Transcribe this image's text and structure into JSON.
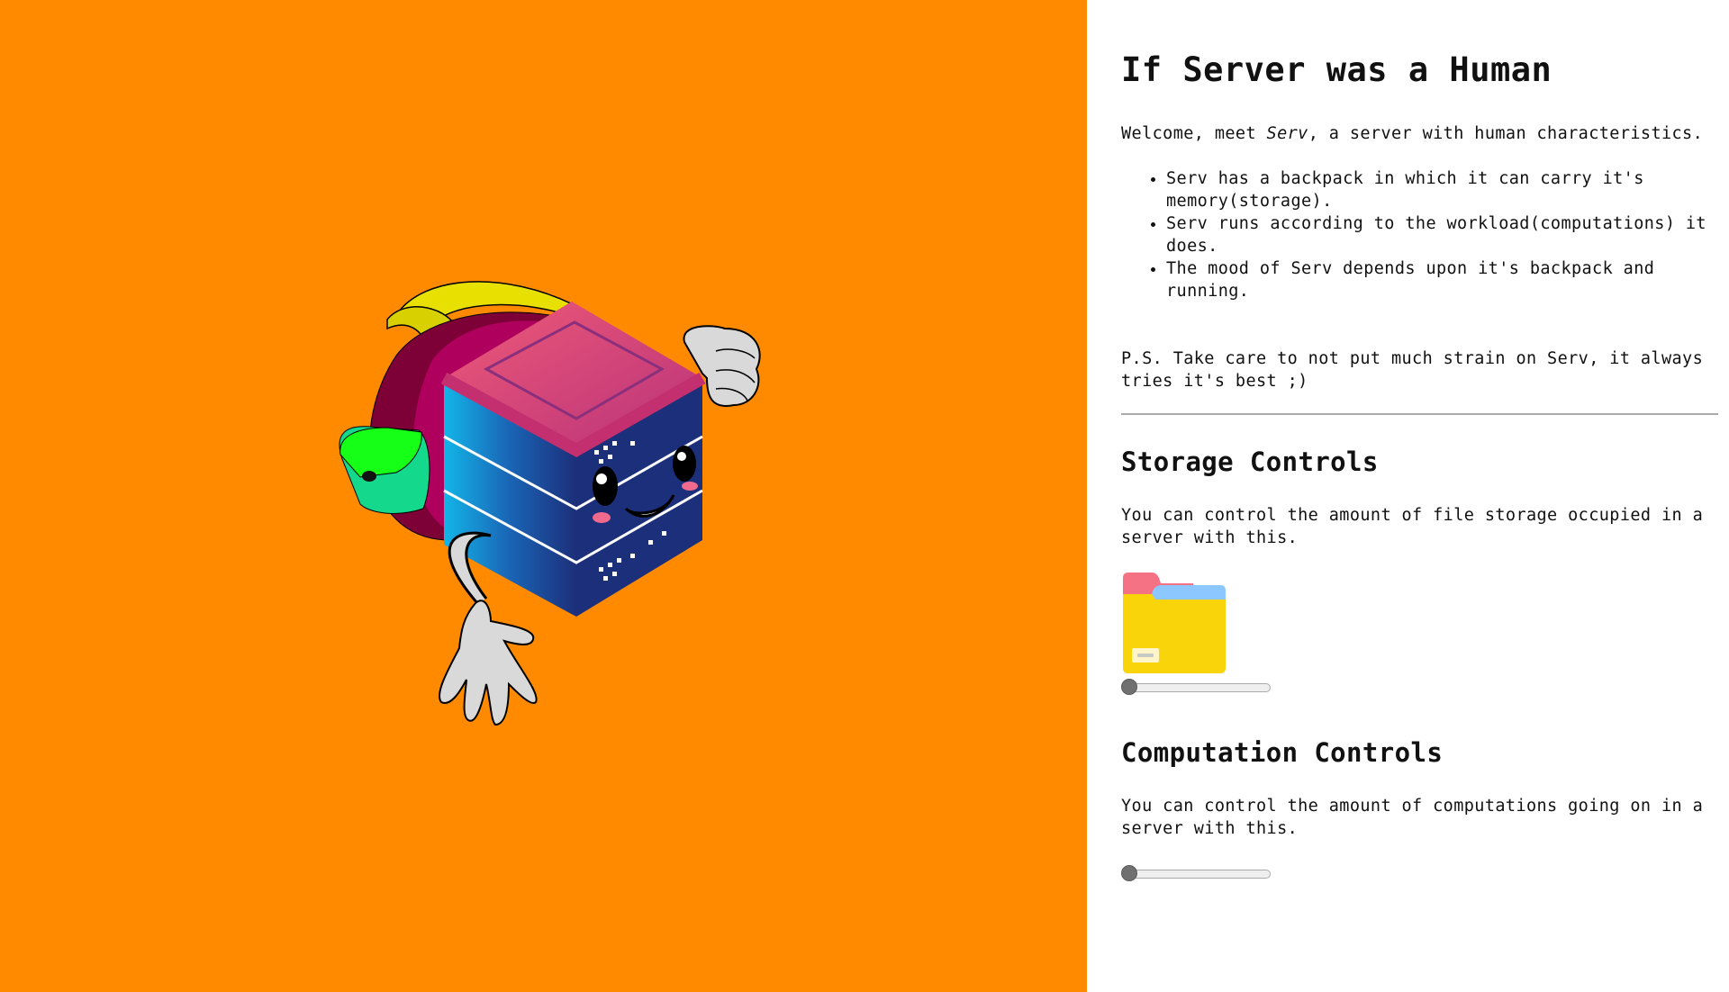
{
  "stage": {
    "background": "#ff8a00",
    "illustration": "server-character-illustration"
  },
  "panel": {
    "title": "If Server was a Human",
    "welcome_before": "Welcome, meet ",
    "welcome_name": "Serv",
    "welcome_after": ", a server with human characteristics.",
    "bullets": [
      "Serv has a backpack in which it can carry it's memory(storage).",
      "Serv runs according to the workload(computations) it does.",
      "The mood of Serv depends upon it's backpack and running."
    ],
    "ps": "P.S. Take care to not put much strain on Serv, it always tries it's best ;)",
    "storage": {
      "title": "Storage Controls",
      "description": "You can control the amount of file storage occupied in a server with this.",
      "icon": "folder-icon",
      "slider_value": 0
    },
    "computation": {
      "title": "Computation Controls",
      "description": "You can control the amount of computations going on in a server with this.",
      "slider_value": 0
    }
  }
}
